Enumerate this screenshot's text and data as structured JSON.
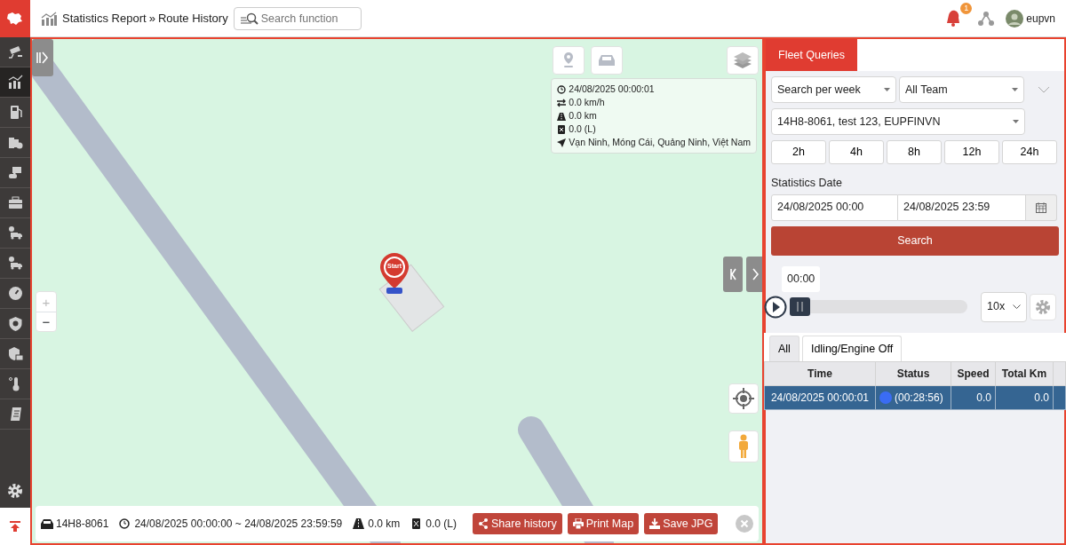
{
  "header": {
    "breadcrumb": [
      "Statistics Report",
      "Route History"
    ],
    "separator": "»",
    "search": {
      "placeholder": "Search function"
    },
    "notification_count": "1",
    "user": "eupvn"
  },
  "sidebar": {
    "items": [
      {
        "selected": false
      },
      {
        "selected": true
      },
      {
        "selected": false
      },
      {
        "selected": false
      },
      {
        "selected": false
      },
      {
        "selected": false
      },
      {
        "selected": false
      },
      {
        "selected": false
      },
      {
        "selected": false
      },
      {
        "selected": false
      },
      {
        "selected": false
      },
      {
        "selected": false
      },
      {
        "selected": false
      }
    ]
  },
  "map": {
    "info": {
      "time": "24/08/2025 00:00:01",
      "speed": "0.0 km/h",
      "distance": "0.0 km",
      "fuel": "0.0 (L)",
      "address": "Vạn Ninh, Móng Cái, Quảng Ninh, Việt Nam"
    },
    "marker": "Start",
    "zoom": {
      "in": "+",
      "out": "−"
    },
    "footer": {
      "plate": "14H8-8061",
      "range": "24/08/2025 00:00:00 ~ 24/08/2025 23:59:59",
      "distance": "0.0 km",
      "fuel": "0.0 (L)",
      "buttons": [
        {
          "kind": "share",
          "label": "Share history"
        },
        {
          "kind": "print",
          "label": "Print Map"
        },
        {
          "kind": "save",
          "label": "Save JPG"
        }
      ]
    }
  },
  "panel": {
    "tabs": [
      {
        "label": "Fleet Queries",
        "selected": true
      }
    ],
    "period_select": "Search per week",
    "team_select": "All Team",
    "vehicle_select": "14H8-8061, test 123, EUPFINVN",
    "hour_buttons": [
      "2h",
      "4h",
      "8h",
      "12h",
      "24h"
    ],
    "date_label": "Statistics Date",
    "date_from": "24/08/2025 00:00",
    "date_to": "24/08/2025 23:59",
    "search_button": "Search",
    "playback": {
      "time": "00:00",
      "level": 0,
      "speed": "10x"
    },
    "subtabs": [
      {
        "label": "All",
        "selected": true
      },
      {
        "label": "Idling/Engine Off",
        "selected": false
      }
    ],
    "table": {
      "columns": [
        "Time",
        "Status",
        "Speed",
        "Total Km"
      ],
      "rows": [
        {
          "time": "24/08/2025 00:00:01",
          "status": "(00:28:56)",
          "color": "#3a6cf4",
          "speed": "0.0",
          "total_km": "0.0",
          "selected": true
        }
      ]
    }
  }
}
